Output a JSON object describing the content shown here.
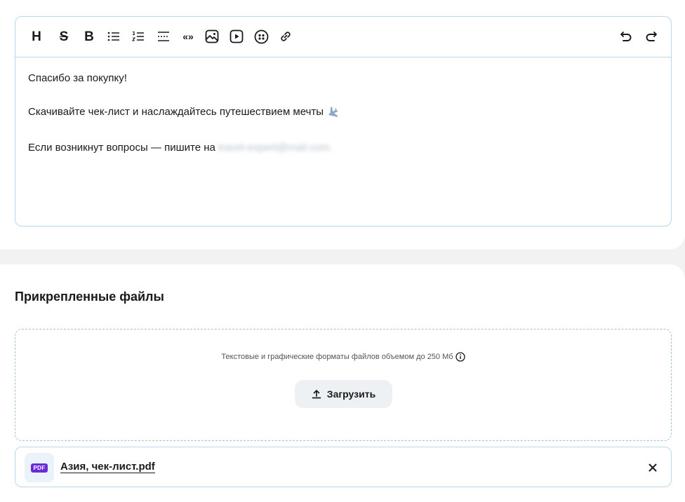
{
  "editor": {
    "toolbar": {
      "heading": "H",
      "strike": "S",
      "bold": "B",
      "quote": "«»"
    },
    "lines": [
      "Спасибо за покупку!",
      "Скачивайте чек-лист и наслаждайтесь путешествием мечты",
      "Если возникнут вопросы — пишите на"
    ],
    "email": "travel-expert@mail.com."
  },
  "attachments": {
    "title": "Прикрепленные файлы",
    "hint": "Текстовые и графические форматы файлов объемом до 250 Мб",
    "upload_label": "Загрузить",
    "files": [
      {
        "badge": "PDF",
        "name": "Азия, чек-лист.pdf"
      }
    ]
  }
}
